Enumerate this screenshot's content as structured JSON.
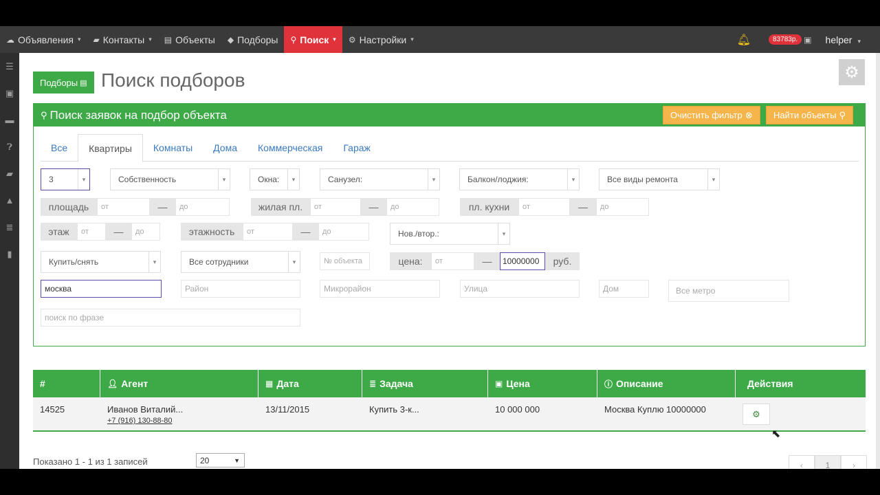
{
  "nav": {
    "items": [
      {
        "label": "Объявления",
        "icon": "cloud-icon"
      },
      {
        "label": "Контакты",
        "icon": "book-icon"
      },
      {
        "label": "Объекты",
        "icon": "building-icon"
      },
      {
        "label": "Подборы",
        "icon": "tag-icon"
      },
      {
        "label": "Поиск",
        "icon": "search-icon"
      },
      {
        "label": "Настройки",
        "icon": "gears-icon"
      }
    ],
    "balance": "83783р.",
    "user": "helper"
  },
  "page": {
    "badge": "Подборы",
    "title": "Поиск подборов"
  },
  "panel": {
    "title": "Поиск заявок на подбор объекта",
    "clear_label": "Очистить фильтр",
    "find_label": "Найти объекты",
    "tabs": [
      "Все",
      "Квартиры",
      "Комнаты",
      "Дома",
      "Коммерческая",
      "Гараж"
    ],
    "filters": {
      "rooms": "3",
      "ownership": "Собственность",
      "windows": "Окна:",
      "bathroom": "Санузел:",
      "balcony": "Балкон/лоджия:",
      "repair": "Все виды ремонта",
      "area_label": "площадь",
      "living_label": "жилая пл.",
      "kitchen_label": "пл. кухни",
      "floor_label": "этаж",
      "floors_label": "этажность",
      "from_ph": "от",
      "to_ph": "до",
      "dash": "—",
      "newsec": "Нов./втор.:",
      "deal": "Купить/снять",
      "staff": "Все сотрудники",
      "object_no_ph": "№ объекта",
      "price_label": "цена:",
      "price_to": "10000000",
      "currency": "руб.",
      "city": "москва",
      "district_ph": "Район",
      "microdistrict_ph": "Микрорайон",
      "street_ph": "Улица",
      "house_ph": "Дом",
      "metro_ph": "Все метро",
      "phrase_ph": "поиск по фразе"
    }
  },
  "table": {
    "headers": [
      "#",
      "Агент",
      "Дата",
      "Задача",
      "Цена",
      "Описание",
      "Действия"
    ],
    "rows": [
      {
        "id": "14525",
        "agent": "Иванов Виталий...",
        "phone": "+7 (916) 130-88-80",
        "date": "13/11/2015",
        "task": "Купить 3-к...",
        "price": "10 000 000",
        "description": "Москва Куплю 10000000"
      }
    ]
  },
  "footer": {
    "shown": "Показано 1 - 1 из 1 записей",
    "page_size": "20",
    "current_page": "1",
    "prev": "‹",
    "next": "›"
  },
  "colors": {
    "brand_green": "#3daa47",
    "active_red": "#e0323a",
    "button_orange": "#f5b54a",
    "nav_bg": "#3a3a3a"
  }
}
